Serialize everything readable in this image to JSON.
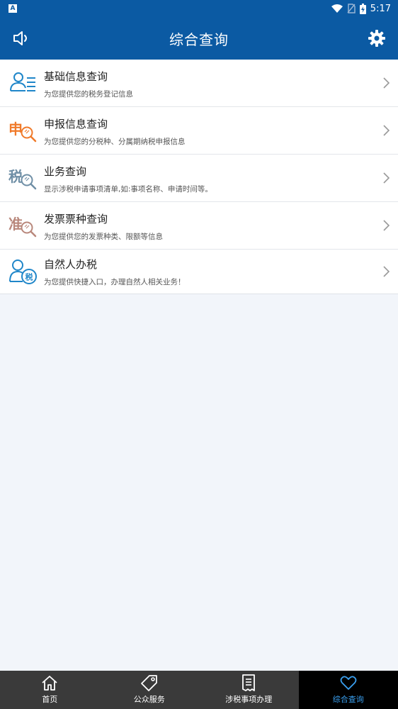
{
  "status_bar": {
    "notification_glyph": "A",
    "time": "5:17",
    "icons": [
      "wifi-icon",
      "no-sim-icon",
      "battery-charging-icon"
    ]
  },
  "header": {
    "title": "综合查询",
    "left_icon": "speaker-icon",
    "right_icon": "gear-icon"
  },
  "menu": {
    "items": [
      {
        "title": "基础信息查询",
        "desc": "为您提供您的税务登记信息",
        "icon": "person-list-icon",
        "icon_color": "#1f86c9"
      },
      {
        "title": "申报信息查询",
        "desc": "为您提供您的分税种、分属期纳税申报信息",
        "icon": "declaration-search-icon",
        "icon_char": "申",
        "icon_color": "#f07a2a"
      },
      {
        "title": "业务查询",
        "desc": "显示涉税申请事项清单,如:事项名称、申请时间等。",
        "icon": "tax-search-icon",
        "icon_char": "税",
        "icon_color": "#6f8fa6"
      },
      {
        "title": "发票票种查询",
        "desc": "为您提供您的发票种类、限额等信息",
        "icon": "approve-search-icon",
        "icon_char": "准",
        "icon_color": "#b9887c"
      },
      {
        "title": "自然人办税",
        "desc": "为您提供快捷入口，办理自然人相关业务！",
        "icon": "person-tax-icon",
        "icon_char": "税",
        "icon_color": "#1f86c9"
      }
    ]
  },
  "tabbar": {
    "tabs": [
      {
        "label": "首页",
        "icon": "home-icon",
        "active": false
      },
      {
        "label": "公众服务",
        "icon": "tag-icon",
        "active": false
      },
      {
        "label": "涉税事项办理",
        "icon": "document-icon",
        "active": false
      },
      {
        "label": "综合查询",
        "icon": "heart-icon",
        "active": true
      }
    ],
    "active_color": "#3aa0f0"
  }
}
